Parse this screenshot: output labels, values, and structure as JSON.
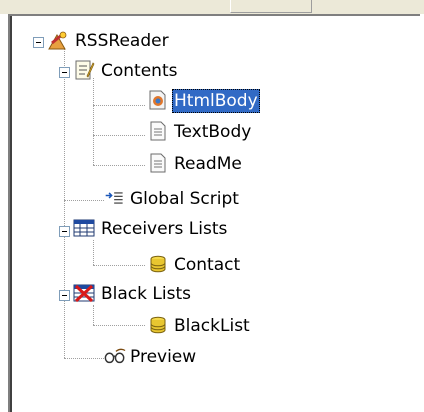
{
  "tree": {
    "root": {
      "label": "RSSReader",
      "icon": "rss-reader-icon"
    },
    "contents": {
      "label": "Contents",
      "icon": "notepad-icon",
      "children": [
        {
          "label": "HtmlBody",
          "icon": "html-document-icon",
          "selected": true
        },
        {
          "label": "TextBody",
          "icon": "text-document-icon"
        },
        {
          "label": "ReadMe",
          "icon": "text-document-icon"
        }
      ]
    },
    "global_script": {
      "label": "Global Script",
      "icon": "script-icon"
    },
    "receivers": {
      "label": "Receivers Lists",
      "icon": "table-icon",
      "children": [
        {
          "label": "Contact",
          "icon": "database-icon"
        }
      ]
    },
    "black_lists": {
      "label": "Black Lists",
      "icon": "blocked-table-icon",
      "children": [
        {
          "label": "BlackList",
          "icon": "database-icon"
        }
      ]
    },
    "preview": {
      "label": "Preview",
      "icon": "glasses-icon"
    }
  },
  "colors": {
    "selection": "#316ac5",
    "tree_lines": "#a0a0a0",
    "expander_border": "#7f9db9"
  }
}
